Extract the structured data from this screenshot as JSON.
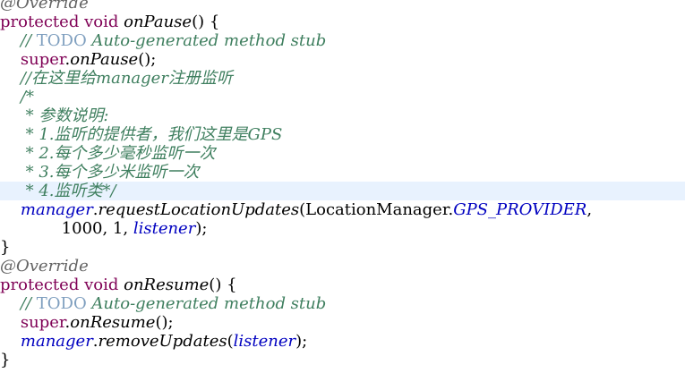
{
  "editor": {
    "lines": [
      {
        "indent": "",
        "tokens": [
          {
            "t": "@Override",
            "c": "anno"
          }
        ]
      },
      {
        "indent": "",
        "tokens": [
          {
            "t": "protected",
            "c": "kw"
          },
          {
            "t": " "
          },
          {
            "t": "void",
            "c": "kw"
          },
          {
            "t": " "
          },
          {
            "t": "onPause",
            "c": "m"
          },
          {
            "t": "() {"
          }
        ]
      },
      {
        "indent": "    ",
        "tokens": [
          {
            "t": "// ",
            "c": "c"
          },
          {
            "t": "TODO",
            "c": "todo"
          },
          {
            "t": " Auto-generated method stub",
            "c": "c"
          }
        ]
      },
      {
        "indent": "    ",
        "tokens": [
          {
            "t": "super",
            "c": "kw"
          },
          {
            "t": "."
          },
          {
            "t": "onPause",
            "c": "m"
          },
          {
            "t": "();"
          }
        ]
      },
      {
        "indent": "    ",
        "tokens": [
          {
            "t": "//在这里给manager注册监听",
            "c": "c"
          }
        ]
      },
      {
        "indent": "    ",
        "tokens": [
          {
            "t": "/*",
            "c": "c"
          }
        ]
      },
      {
        "indent": "     ",
        "tokens": [
          {
            "t": "* 参数说明:",
            "c": "c"
          }
        ]
      },
      {
        "indent": "     ",
        "tokens": [
          {
            "t": "* 1.监听的提供者，我们这里是GPS",
            "c": "c"
          }
        ]
      },
      {
        "indent": "     ",
        "tokens": [
          {
            "t": "* 2.每个多少毫秒监听一次",
            "c": "c"
          }
        ]
      },
      {
        "indent": "     ",
        "tokens": [
          {
            "t": "* 3.每个多少米监听一次",
            "c": "c"
          }
        ]
      },
      {
        "indent": "     ",
        "highlight": true,
        "tokens": [
          {
            "t": "* 4.监听类*/",
            "c": "c"
          }
        ]
      },
      {
        "indent": "    ",
        "tokens": [
          {
            "t": "manager",
            "c": "fld"
          },
          {
            "t": "."
          },
          {
            "t": "requestLocationUpdates",
            "c": "m"
          },
          {
            "t": "(LocationManager."
          },
          {
            "t": "GPS_PROVIDER",
            "c": "const"
          },
          {
            "t": ","
          }
        ]
      },
      {
        "indent": "            ",
        "tokens": [
          {
            "t": "1000, 1, "
          },
          {
            "t": "listener",
            "c": "fld"
          },
          {
            "t": ");"
          }
        ]
      },
      {
        "indent": "",
        "tokens": [
          {
            "t": "}"
          }
        ]
      },
      {
        "indent": "",
        "tokens": [
          {
            "t": "@Override",
            "c": "anno"
          }
        ]
      },
      {
        "indent": "",
        "tokens": [
          {
            "t": "protected",
            "c": "kw"
          },
          {
            "t": " "
          },
          {
            "t": "void",
            "c": "kw"
          },
          {
            "t": " "
          },
          {
            "t": "onResume",
            "c": "m"
          },
          {
            "t": "() {"
          }
        ]
      },
      {
        "indent": "    ",
        "tokens": [
          {
            "t": "// ",
            "c": "c"
          },
          {
            "t": "TODO",
            "c": "todo"
          },
          {
            "t": " Auto-generated method stub",
            "c": "c"
          }
        ]
      },
      {
        "indent": "    ",
        "tokens": [
          {
            "t": "super",
            "c": "kw"
          },
          {
            "t": "."
          },
          {
            "t": "onResume",
            "c": "m"
          },
          {
            "t": "();"
          }
        ]
      },
      {
        "indent": "    ",
        "tokens": [
          {
            "t": "manager",
            "c": "fld"
          },
          {
            "t": "."
          },
          {
            "t": "removeUpdates",
            "c": "m"
          },
          {
            "t": "("
          },
          {
            "t": "listener",
            "c": "fld"
          },
          {
            "t": ");"
          }
        ]
      },
      {
        "indent": "",
        "tokens": [
          {
            "t": "}"
          }
        ]
      }
    ]
  },
  "colors": {
    "annotation": "#646464",
    "keyword": "#7f0055",
    "comment": "#3f7f5f",
    "todo": "#7f9fbf",
    "field": "#0000c0",
    "current_line_highlight": "#e8f2fe"
  }
}
